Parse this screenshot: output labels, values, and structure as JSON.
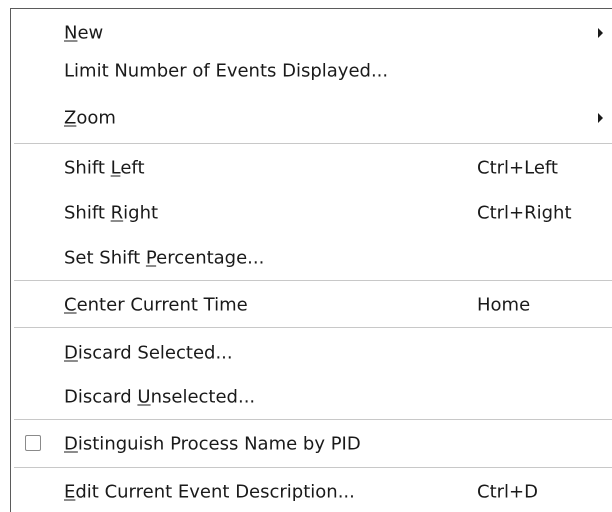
{
  "menu": {
    "items": [
      {
        "pre": "",
        "key": "N",
        "post": "ew",
        "shortcut": "",
        "submenu_icon": "chevron-right-icon"
      },
      {
        "pre": "Limit Number of Events Displayed...",
        "key": "",
        "post": "",
        "shortcut": ""
      },
      {
        "pre": "",
        "key": "Z",
        "post": "oom",
        "shortcut": "",
        "submenu_icon": "chevron-right-icon"
      },
      {
        "pre": "Shift ",
        "key": "L",
        "post": "eft",
        "shortcut": "Ctrl+Left"
      },
      {
        "pre": "Shift ",
        "key": "R",
        "post": "ight",
        "shortcut": "Ctrl+Right"
      },
      {
        "pre": "Set Shift ",
        "key": "P",
        "post": "ercentage...",
        "shortcut": ""
      },
      {
        "pre": "",
        "key": "C",
        "post": "enter Current Time",
        "shortcut": "Home"
      },
      {
        "pre": "",
        "key": "D",
        "post": "iscard Selected...",
        "shortcut": ""
      },
      {
        "pre": "Discard ",
        "key": "U",
        "post": "nselected...",
        "shortcut": ""
      },
      {
        "pre": "",
        "key": "D",
        "post": "istinguish Process Name by PID",
        "shortcut": "",
        "checkbox_checked": false
      },
      {
        "pre": "",
        "key": "E",
        "post": "dit Current Event Description...",
        "shortcut": "Ctrl+D"
      }
    ]
  }
}
